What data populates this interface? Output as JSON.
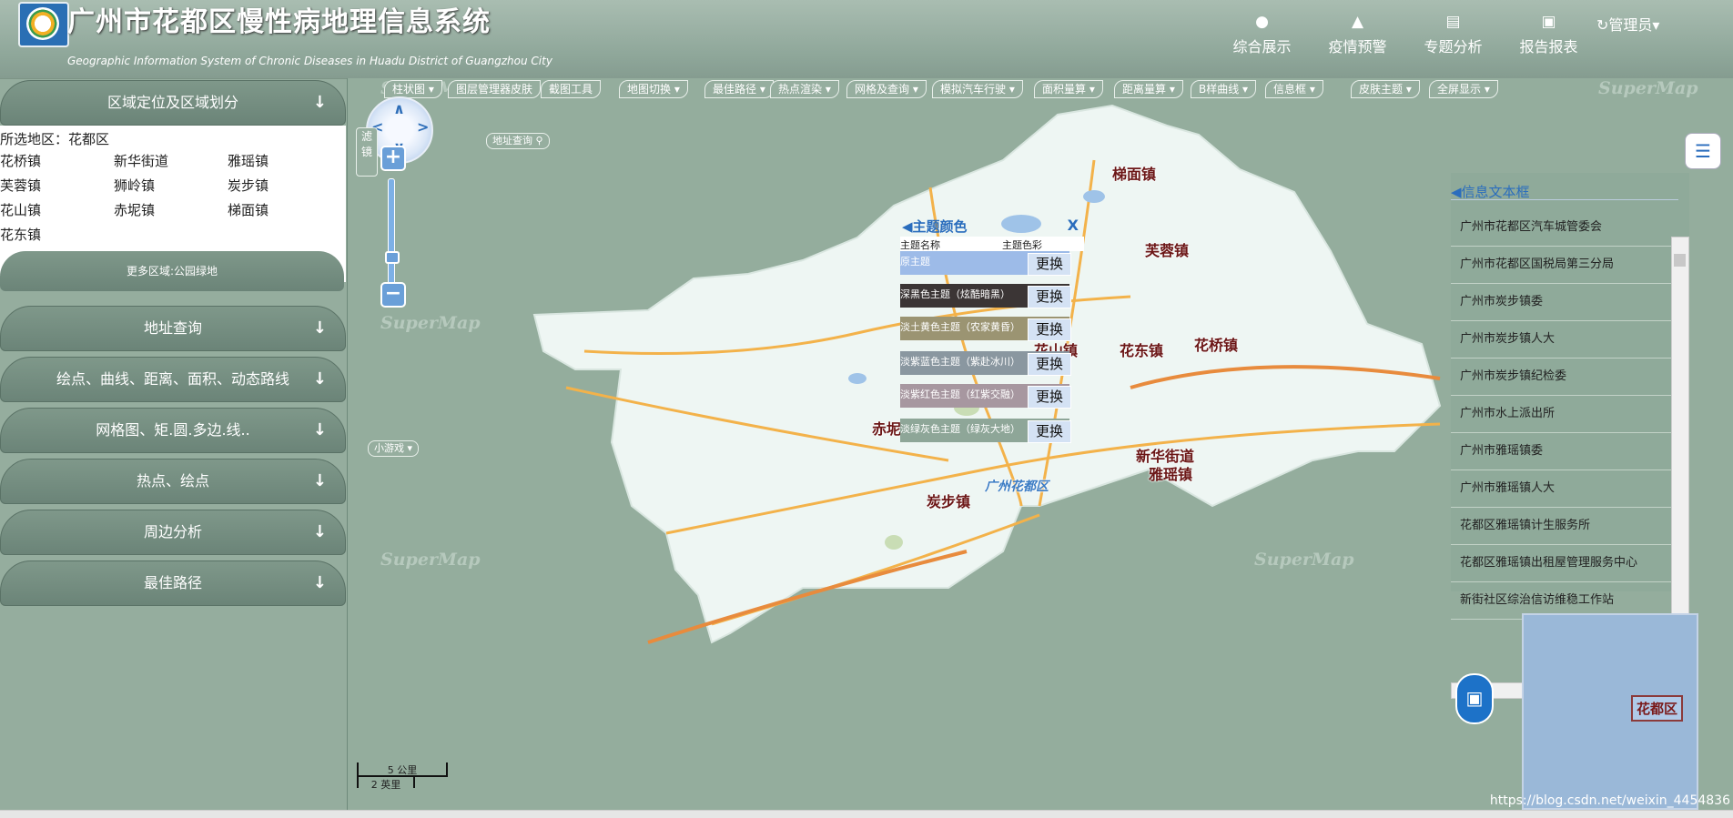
{
  "header": {
    "title": "广州市花都区慢性病地理信息系统",
    "subtitle": "Geographic Information System of Chronic Diseases in Huadu District of Guangzhou City",
    "nav": [
      {
        "label": "综合展示",
        "icon": "user-icon"
      },
      {
        "label": "疫情预警",
        "icon": "flame-icon"
      },
      {
        "label": "专题分析",
        "icon": "chart-icon"
      },
      {
        "label": "报告报表",
        "icon": "image-icon"
      }
    ],
    "user_label": "管理员"
  },
  "sidebar": {
    "region_panel_title": "区域定位及区域划分",
    "selected_region": "所选地区：花都区",
    "towns": [
      "花桥镇",
      "新华街道",
      "雅瑶镇",
      "芙蓉镇",
      "狮岭镇",
      "炭步镇",
      "花山镇",
      "赤坭镇",
      "梯面镇",
      "花东镇"
    ],
    "more_button": "更多区域:公园绿地",
    "sections": [
      "地址查询",
      "绘点、曲线、距离、面积、动态路线",
      "网格图、矩.圆.多边.线..",
      "热点、绘点",
      "周边分析",
      "最佳路径"
    ]
  },
  "map": {
    "toolbar": [
      "柱状图",
      "图层管理器皮肤",
      "截图工具",
      "地图切换",
      "最佳路径",
      "热点渲染",
      "网格及查询",
      "模拟汽车行驶",
      "面积量算",
      "距离量算",
      "B样曲线",
      "信息框",
      "皮肤主题",
      "全屏显示"
    ],
    "watermark": "SuperMap",
    "filter_label": "滤镜",
    "address_query": "地址查询",
    "mini_game": "小游戏",
    "places": [
      "梯面镇",
      "芙蓉镇",
      "花山镇",
      "花东镇",
      "花桥镇",
      "赤坭镇",
      "新华街道",
      "雅瑶镇",
      "炭步镇",
      "广州花都区"
    ],
    "scale": {
      "metric": "5 公里",
      "imperial": "2 英里"
    },
    "credit": "https://blog.csdn.net/weixin_4454836",
    "overview_label": "花都区"
  },
  "theme_popup": {
    "title": "主题颜色",
    "close": "X",
    "col_name": "主题名称",
    "col_color": "主题色彩",
    "change_label": "更换",
    "themes": [
      {
        "name": "原主题",
        "color": "#9dbbe8"
      },
      {
        "name": "深黑色主题（炫酷暗黑）",
        "color": "#3b3535"
      },
      {
        "name": "淡土黄色主题（农家黄昏）",
        "color": "#9b9472"
      },
      {
        "name": "淡紫蓝色主题（紫赴冰川）",
        "color": "#8a97a0"
      },
      {
        "name": "淡紫红色主题（红紫交融）",
        "color": "#a797a0"
      },
      {
        "name": "淡绿灰色主题（绿灰大地）",
        "color": "#8ea698"
      }
    ]
  },
  "info_box": {
    "title": "信息文本框",
    "items": [
      "广州市花都区汽车城管委会",
      "广州市花都区国税局第三分局",
      "广州市炭步镇委",
      "广州市炭步镇人大",
      "广州市炭步镇纪检委",
      "广州市水上派出所",
      "广州市雅瑶镇委",
      "广州市雅瑶镇人大",
      "花都区雅瑶镇计生服务所",
      "花都区雅瑶镇出租屋管理服务中心",
      "新街社区综治信访维稳工作站"
    ]
  }
}
